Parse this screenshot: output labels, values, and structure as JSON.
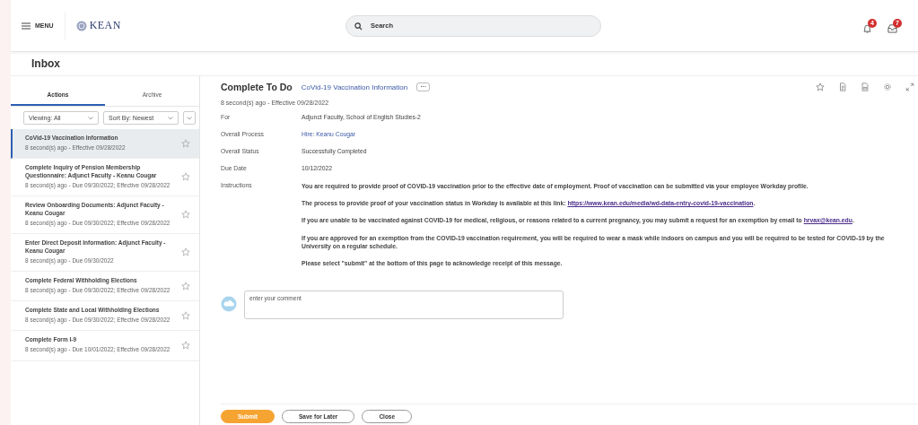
{
  "header": {
    "menu_label": "MENU",
    "logo_text": "KEAN",
    "search": {
      "placeholder": "Search"
    },
    "notification_badge": "4",
    "inbox_badge": "7"
  },
  "page_title": "Inbox",
  "tabs": [
    {
      "label": "Actions",
      "selected": true
    },
    {
      "label": "Archive",
      "selected": false
    }
  ],
  "filters": [
    {
      "label": "Viewing: All"
    },
    {
      "label": "Sort By: Newest"
    }
  ],
  "inbox_items": [
    {
      "title": "CoVid-19 Vaccination Information",
      "meta": "8 second(s) ago - Effective 09/28/2022",
      "selected": true
    },
    {
      "title": "Complete Inquiry of Pension Membership Questionnaire: Adjunct Faculty - Keanu Cougar",
      "meta": "8 second(s) ago - Due 09/30/2022; Effective 09/28/2022",
      "selected": false
    },
    {
      "title": "Review Onboarding Documents: Adjunct Faculty - Keanu Cougar",
      "meta": "8 second(s) ago - Due 09/30/2022; Effective 09/28/2022",
      "selected": false
    },
    {
      "title": "Enter Direct Deposit Information: Adjunct Faculty - Keanu Cougar",
      "meta": "8 second(s) ago - Due 09/30/2022",
      "selected": false
    },
    {
      "title": "Complete Federal Withholding Elections",
      "meta": "8 second(s) ago - Due 09/30/2022; Effective 09/28/2022",
      "selected": false
    },
    {
      "title": "Complete State and Local Withholding Elections",
      "meta": "8 second(s) ago - Due 09/30/2022; Effective 09/28/2022",
      "selected": false
    },
    {
      "title": "Complete Form I-9",
      "meta": "8 second(s) ago - Due 10/01/2022; Effective 09/28/2022",
      "selected": false
    }
  ],
  "detail": {
    "heading": "Complete To Do",
    "subject_link": "CoVid-19 Vaccination Information",
    "more_label": "···",
    "meta": "8 second(s) ago - Effective 09/28/2022",
    "fields": [
      {
        "label": "For",
        "value": "Adjunct Faculty, School of English Studies-2",
        "kind": "text"
      },
      {
        "label": "Overall Process",
        "value": "Hire: Keanu Cougar",
        "kind": "link"
      },
      {
        "label": "Overall Status",
        "value": "Successfully Completed",
        "kind": "text"
      },
      {
        "label": "Due Date",
        "value": "10/12/2022",
        "kind": "text"
      }
    ],
    "instructions_label": "Instructions",
    "instructions": [
      {
        "text": "You are required to provide proof of COVID-19 vaccination prior to the effective date of employment. Proof of vaccination can be submitted via your employee Workday profile."
      },
      {
        "text": "The process to provide proof of your vaccination status in Workday is available at this link: ",
        "link": "https://www.kean.edu/media/wd-data-entry-covid-19-vaccination",
        "after": "."
      },
      {
        "text": "If you are unable to be vaccinated against COVID-19 for medical, religious, or reasons related to a current pregnancy, you may submit a request for an exemption by email to ",
        "link": "hrvax@kean.edu",
        "after": "."
      },
      {
        "text": "If you are approved for an exemption from the COVID-19 vaccination requirement, you will be required to wear a mask while indoors on campus and you will be required to be tested for COVID-19 by the University on a regular schedule."
      },
      {
        "text": "Please select \"submit\" at the bottom of this page to acknowledge receipt of this message."
      }
    ],
    "comment": {
      "placeholder": "enter your comment"
    }
  },
  "buttons": [
    {
      "label": "Submit",
      "kind": "primary"
    },
    {
      "label": "Save for Later",
      "kind": "secondary"
    },
    {
      "label": "Close",
      "kind": "secondary"
    }
  ]
}
